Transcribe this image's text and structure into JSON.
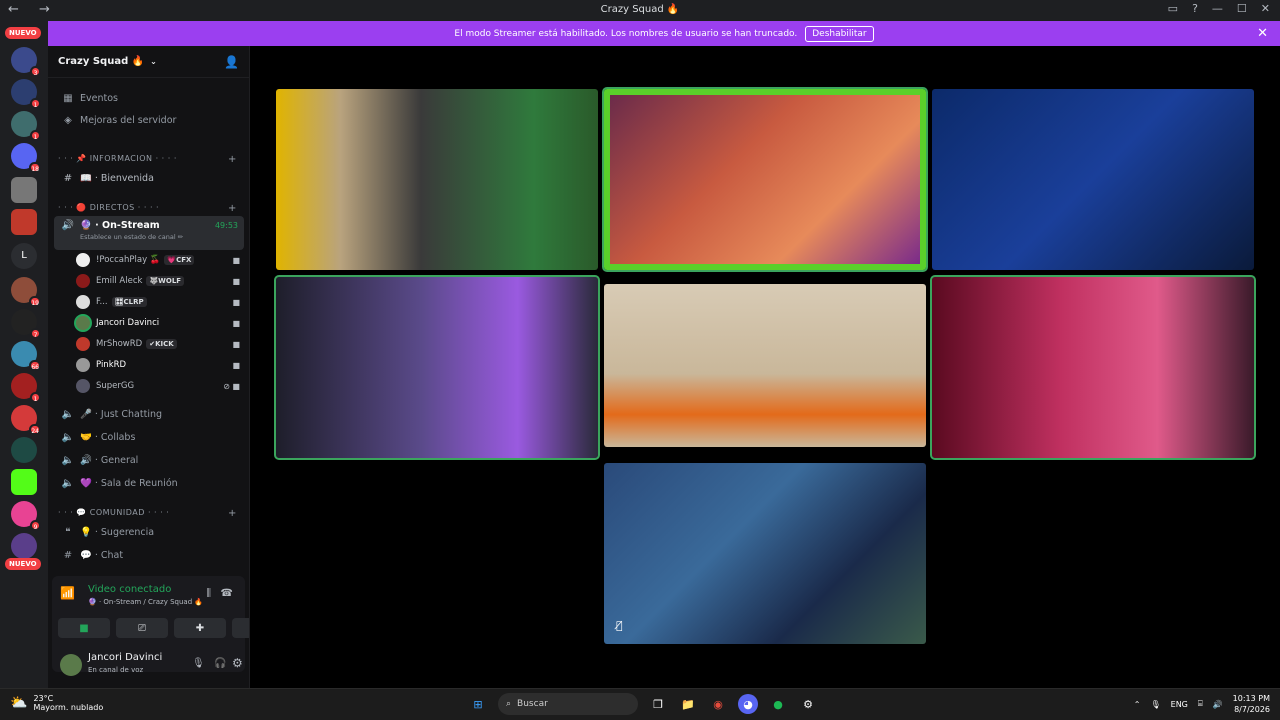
{
  "window": {
    "title": "Crazy Squad 🔥"
  },
  "banner": {
    "text": "El modo Streamer está habilitado. Los nombres de usuario se han truncado.",
    "button": "Deshabilitar"
  },
  "servers": {
    "nuevo_top": "NUEVO",
    "nuevo_bottom": "NUEVO",
    "badges": [
      "3",
      "1",
      "1",
      "18",
      "19",
      "7",
      "66",
      "1",
      "24",
      "9"
    ],
    "letter": "L"
  },
  "guild": {
    "name": "Crazy Squad 🔥"
  },
  "sidebar": {
    "events": "Eventos",
    "boosts": "Mejoras del servidor",
    "cat_info": "· · · 📌 INFORMACION · · · ·",
    "welcome": "📖 · Bienvenida",
    "cat_direct": "· · · 🔴 DIRECTOS · · · ·",
    "onstream": "🔮 · On-Stream",
    "onstream_timer": "49:53",
    "onstream_sub": "Establece un estado de canal ✏",
    "users": [
      {
        "name": "!PoccahPlay 🍒",
        "tag": "💗CFX"
      },
      {
        "name": "Emill Aleck",
        "tag": "🐺WOLF"
      },
      {
        "name": "F...",
        "tag": "🎛CLRP"
      },
      {
        "name": "Jancori Davinci",
        "tag": ""
      },
      {
        "name": "MrShowRD",
        "tag": "✔KICK"
      },
      {
        "name": "PinkRD",
        "tag": ""
      },
      {
        "name": "SuperGG",
        "tag": ""
      }
    ],
    "just_chatting": "🎤 · Just Chatting",
    "collabs": "🤝 · Collabs",
    "general": "🔊 · General",
    "sala": "💜 · Sala de Reunión",
    "cat_comunidad": "· · · 💬 COMUNIDAD · · · ·",
    "sugerencia": "💡 · Sugerencia",
    "chat": "💬 · Chat"
  },
  "voice": {
    "status": "Video conectado",
    "sub": "🔮 · On-Stream / Crazy Squad 🔥"
  },
  "user": {
    "name": "Jancori Davinci",
    "status": "En canal de voz"
  },
  "taskbar": {
    "temp": "23°C",
    "weather": "Mayorm. nublado",
    "search": "Buscar",
    "lang": "ENG",
    "time": "10:13 PM",
    "date": "8/7/2026"
  },
  "colors": {
    "accent": "#9b3ff0",
    "speaking": "#3ba55d",
    "danger": "#f23f43"
  }
}
